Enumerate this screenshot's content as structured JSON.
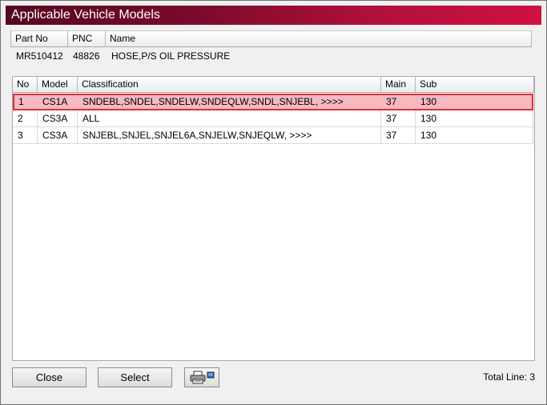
{
  "window": {
    "title": "Applicable Vehicle Models"
  },
  "part_info": {
    "headers": {
      "part_no": "Part No",
      "pnc": "PNC",
      "name": "Name"
    },
    "values": {
      "part_no": "MR510412",
      "pnc": "48826",
      "name": "HOSE,P/S OIL PRESSURE"
    }
  },
  "models_table": {
    "headers": {
      "no": "No",
      "model": "Model",
      "classification": "Classification",
      "main": "Main",
      "sub": "Sub"
    },
    "rows": [
      {
        "no": "1",
        "model": "CS1A",
        "classification": "SNDEBL,SNDEL,SNDELW,SNDEQLW,SNDL,SNJEBL,  >>>>",
        "main": "37",
        "sub": "130"
      },
      {
        "no": "2",
        "model": "CS3A",
        "classification": "ALL",
        "main": "37",
        "sub": "130"
      },
      {
        "no": "3",
        "model": "CS3A",
        "classification": "SNJEBL,SNJEL,SNJEL6A,SNJELW,SNJEQLW,  >>>>",
        "main": "37",
        "sub": "130"
      }
    ],
    "selected_row": 0
  },
  "footer": {
    "close_label": "Close",
    "select_label": "Select",
    "print_icon": "printer-icon",
    "total_line": "Total Line: 3"
  },
  "colors": {
    "title_gradient_start": "#56061e",
    "title_gradient_end": "#cf1141",
    "selected_row_fill": "#f7b8bf",
    "selected_row_border": "#d8323c"
  }
}
